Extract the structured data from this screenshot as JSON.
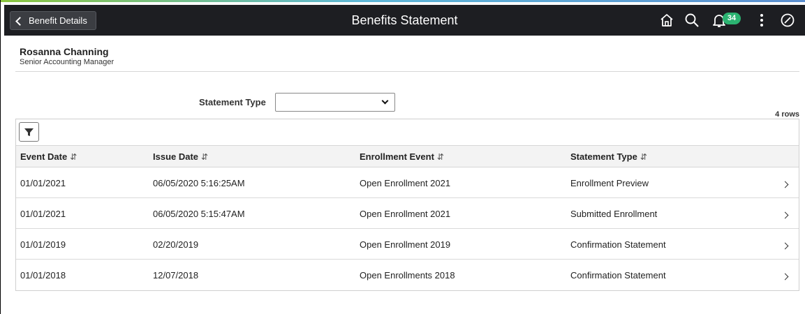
{
  "header": {
    "back_label": "Benefit Details",
    "title": "Benefits Statement",
    "notification_count": "34",
    "icons": [
      "home-icon",
      "search-icon",
      "bell-icon",
      "more-icon",
      "compass-icon"
    ]
  },
  "person": {
    "name": "Rosanna Channing",
    "job_title": "Senior Accounting Manager"
  },
  "filter": {
    "statement_type_label": "Statement Type",
    "statement_type_value": ""
  },
  "grid": {
    "row_count": "4 rows",
    "columns": [
      "Event Date",
      "Issue Date",
      "Enrollment Event",
      "Statement Type"
    ],
    "rows": [
      {
        "event_date": "01/01/2021",
        "issue_date": "06/05/2020  5:16:25AM",
        "enrollment_event": "Open Enrollment 2021",
        "statement_type": "Enrollment Preview"
      },
      {
        "event_date": "01/01/2021",
        "issue_date": "06/05/2020  5:15:47AM",
        "enrollment_event": "Open Enrollment 2021",
        "statement_type": "Submitted Enrollment"
      },
      {
        "event_date": "01/01/2019",
        "issue_date": "02/20/2019",
        "enrollment_event": "Open Enrollment 2019",
        "statement_type": "Confirmation Statement"
      },
      {
        "event_date": "01/01/2018",
        "issue_date": "12/07/2018",
        "enrollment_event": "Open Enrollments 2018",
        "statement_type": "Confirmation Statement"
      }
    ]
  },
  "colors": {
    "header_bg": "#1d1e22",
    "badge": "#2bb371"
  }
}
